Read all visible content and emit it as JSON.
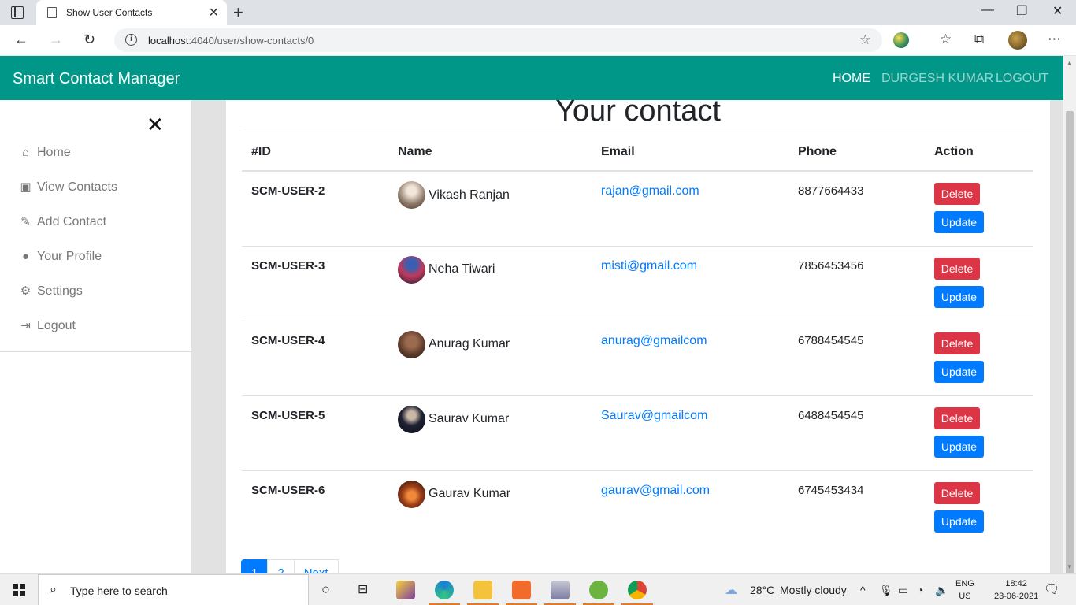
{
  "browser": {
    "tab_title": "Show User Contacts",
    "url_host": "localhost",
    "url_path": ":4040/user/show-contacts/0"
  },
  "navbar": {
    "brand": "Smart Contact Manager",
    "links": [
      "HOME",
      "DURGESH KUMAR",
      "LOGOUT"
    ]
  },
  "sidebar": {
    "items": [
      {
        "label": "Home",
        "icon": "home-icon"
      },
      {
        "label": "View Contacts",
        "icon": "id-card-icon"
      },
      {
        "label": "Add Contact",
        "icon": "pencil-icon"
      },
      {
        "label": "Your Profile",
        "icon": "user-circle-icon"
      },
      {
        "label": "Settings",
        "icon": "cogs-icon"
      },
      {
        "label": "Logout",
        "icon": "sign-out-icon"
      }
    ]
  },
  "main": {
    "heading": "Your contact",
    "columns": [
      "#ID",
      "Name",
      "Email",
      "Phone",
      "Action"
    ],
    "rows": [
      {
        "id": "SCM-USER-2",
        "name": "Vikash Ranjan",
        "email": "rajan@gmail.com",
        "phone": "8877664433"
      },
      {
        "id": "SCM-USER-3",
        "name": "Neha Tiwari",
        "email": "misti@gmail.com",
        "phone": "7856453456"
      },
      {
        "id": "SCM-USER-4",
        "name": "Anurag Kumar",
        "email": "anurag@gmailcom",
        "phone": "6788454545"
      },
      {
        "id": "SCM-USER-5",
        "name": "Saurav Kumar",
        "email": "Saurav@gmailcom",
        "phone": "6488454545"
      },
      {
        "id": "SCM-USER-6",
        "name": "Gaurav Kumar",
        "email": "gaurav@gmail.com",
        "phone": "6745453434"
      }
    ],
    "delete_label": "Delete",
    "update_label": "Update",
    "pagination": [
      "1",
      "2",
      "Next"
    ]
  },
  "taskbar": {
    "search_placeholder": "Type here to search",
    "weather": "28°C",
    "weather_desc": "Mostly cloudy",
    "lang": "ENG",
    "region": "US",
    "time": "18:42",
    "date": "23-06-2021"
  }
}
